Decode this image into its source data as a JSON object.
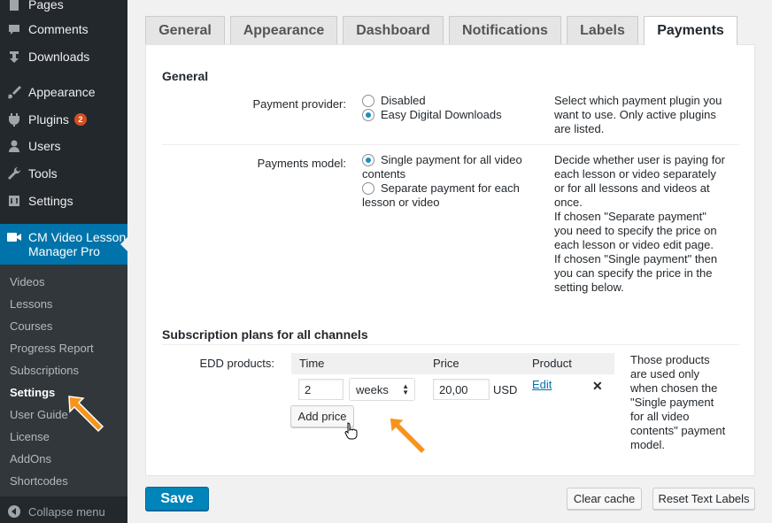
{
  "sidebar": {
    "items": [
      {
        "label": "Pages",
        "icon": "pages-icon"
      },
      {
        "label": "Comments",
        "icon": "comments-icon"
      },
      {
        "label": "Downloads",
        "icon": "downloads-icon"
      },
      {
        "label": "Appearance",
        "icon": "paintbrush-icon"
      },
      {
        "label": "Plugins",
        "icon": "plugins-icon",
        "badge": "2"
      },
      {
        "label": "Users",
        "icon": "users-icon"
      },
      {
        "label": "Tools",
        "icon": "wrench-icon"
      },
      {
        "label": "Settings",
        "icon": "settings-icon"
      }
    ],
    "active": {
      "label_line1": "CM Video Lesson",
      "label_line2": "Manager Pro",
      "icon": "video-camera-icon"
    },
    "submenu": [
      "Videos",
      "Lessons",
      "Courses",
      "Progress Report",
      "Subscriptions",
      "Settings",
      "User Guide",
      "License",
      "AddOns",
      "Shortcodes"
    ],
    "submenu_current": "Settings",
    "collapse_label": "Collapse menu"
  },
  "tabs": [
    "General",
    "Appearance",
    "Dashboard",
    "Notifications",
    "Labels",
    "Payments"
  ],
  "active_tab": "Payments",
  "general": {
    "title": "General",
    "payment_provider": {
      "label": "Payment provider:",
      "options": [
        "Disabled",
        "Easy Digital Downloads"
      ],
      "selected": "Easy Digital Downloads",
      "description": [
        "Select which payment plugin you",
        "want to use. Only active plugins",
        "are listed."
      ]
    },
    "payments_model": {
      "label": "Payments model:",
      "options": [
        {
          "line1": "Single payment for all video",
          "line2": "contents"
        },
        {
          "line1": "Separate payment for each",
          "line2": "lesson or video"
        }
      ],
      "selected": "Single payment for all video contents",
      "description": [
        "Decide whether user is paying for",
        "each lesson or video separately",
        "or for all lessons and videos at",
        "once.",
        "If chosen \"Separate payment\"",
        "you need to specify the price on",
        "each lesson or video edit page.",
        "If chosen \"Single payment\" then",
        "you can specify the price in the",
        "setting below."
      ]
    }
  },
  "subscription": {
    "title": "Subscription plans for all channels",
    "label": "EDD products:",
    "columns": [
      "Time",
      "Price",
      "Product"
    ],
    "row": {
      "time_value": "2",
      "period": "weeks",
      "price": "20,00",
      "currency": "USD",
      "product_link": "Edit",
      "remove_glyph": "✕"
    },
    "add_button": "Add price",
    "description": [
      "Those products",
      "are used only",
      "when chosen the",
      "\"Single payment",
      "for all video",
      "contents\" payment",
      "model."
    ]
  },
  "footer": {
    "save": "Save",
    "clear_cache": "Clear cache",
    "reset_labels": "Reset Text Labels"
  },
  "colors": {
    "accent": "#0073aa",
    "primary_button": "#0085ba",
    "sidebar": "#23282d",
    "annotation_arrow": "#f7941d"
  }
}
